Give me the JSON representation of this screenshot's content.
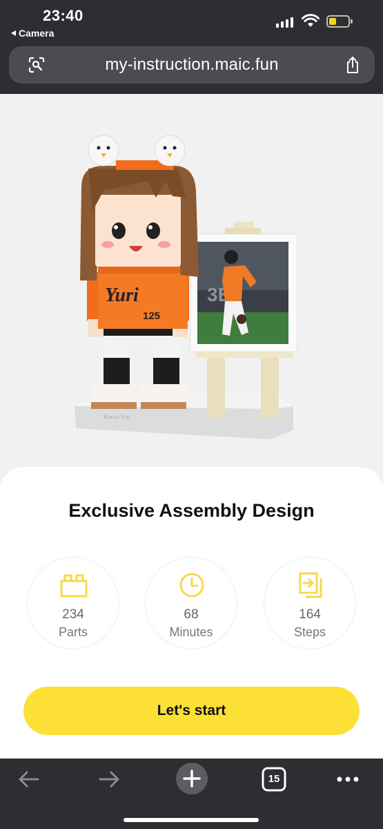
{
  "status": {
    "time": "23:40",
    "back_app": "Camera"
  },
  "browser": {
    "url": "my-instruction.maic.fun",
    "tab_count": "15"
  },
  "figure": {
    "shirt_text": "Yuri",
    "shirt_number": "125",
    "base_text": "Kawaii Yuri"
  },
  "card": {
    "title": "Exclusive Assembly Design",
    "stats": [
      {
        "icon": "brick-icon",
        "value": "234",
        "label": "Parts"
      },
      {
        "icon": "clock-icon",
        "value": "68",
        "label": "Minutes"
      },
      {
        "icon": "steps-icon",
        "value": "164",
        "label": "Steps"
      }
    ],
    "start_label": "Let's start"
  },
  "colors": {
    "accent_yellow": "#fde036",
    "icon_yellow": "#f7d84a",
    "chrome_dark": "#2c2e31"
  }
}
